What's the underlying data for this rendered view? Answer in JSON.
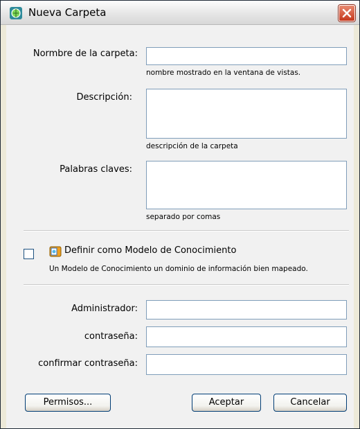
{
  "window": {
    "title": "Nueva Carpeta"
  },
  "form": {
    "folder_name": {
      "label": "Normbre de la carpeta:",
      "hint": "nombre mostrado en la ventana de vistas.",
      "value": ""
    },
    "description": {
      "label": "Descripción:",
      "hint": "descripción de la carpeta",
      "value": ""
    },
    "keywords": {
      "label": "Palabras claves:",
      "hint": "separado por comas",
      "value": ""
    },
    "knowledge_model": {
      "label": "Definir como Modelo de Conocimiento",
      "description": "Un Modelo de Conocimiento un dominio de información bien mapeado.",
      "checked": false
    },
    "administrator": {
      "label": "Administrador:",
      "value": ""
    },
    "password": {
      "label": "contraseña:",
      "value": ""
    },
    "confirm_password": {
      "label": "confirmar contraseña:",
      "value": ""
    }
  },
  "buttons": {
    "permissions": "Permisos...",
    "accept": "Aceptar",
    "cancel": "Cancelar"
  },
  "colors": {
    "title_bar": "#e4e4e4",
    "panel": "#f1f1f1",
    "field_border": "#7f9db9",
    "close_button": "#c5371c"
  },
  "icons": {
    "app": "folder-globe-icon",
    "close": "close-icon",
    "knowledge_model": "knowledge-model-icon"
  }
}
